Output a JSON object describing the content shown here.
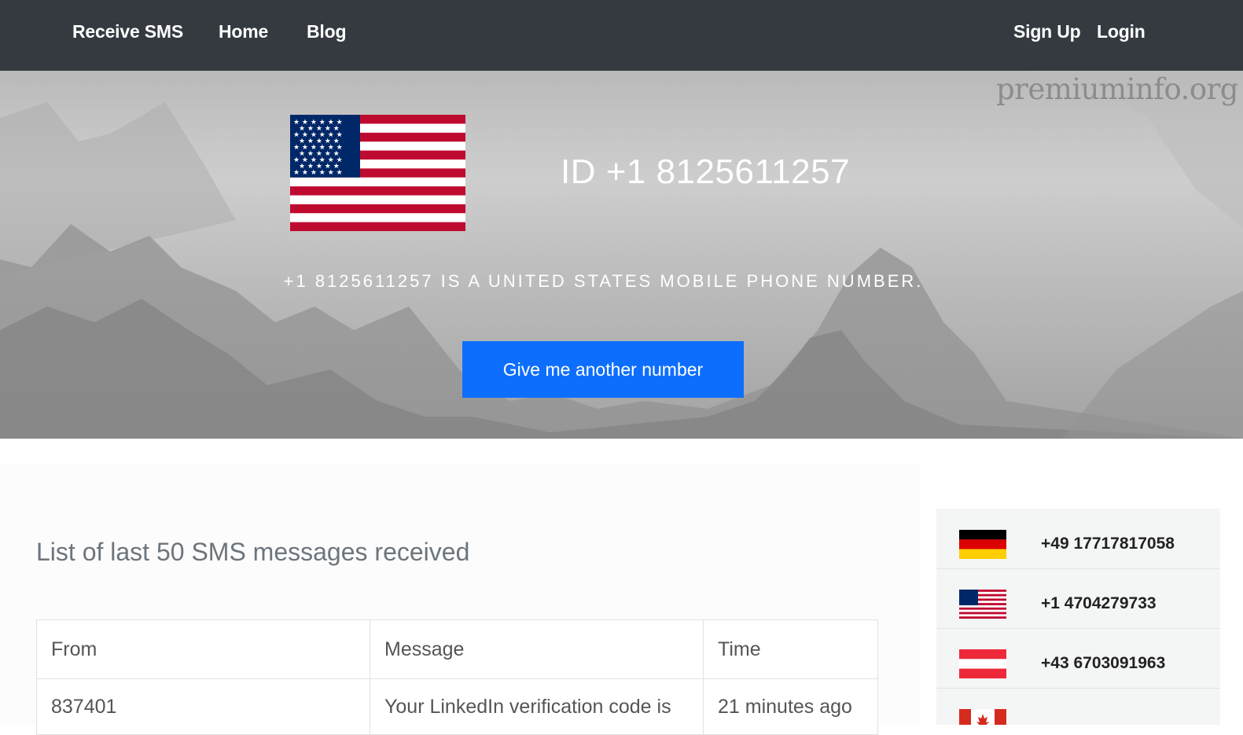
{
  "nav": {
    "brand": "Receive SMS",
    "home": "Home",
    "blog": "Blog",
    "signup": "Sign Up",
    "login": "Login"
  },
  "hero": {
    "watermark": "premiuminfo.org",
    "flag_icon": "us-flag-icon",
    "id_text": "ID +1 8125611257",
    "subtitle": "+1 8125611257 is a United States mobile phone number.",
    "cta_label": "Give me another number"
  },
  "messages": {
    "title": "List of last 50 SMS messages received",
    "columns": [
      "From",
      "Message",
      "Time"
    ],
    "rows": [
      {
        "from": "837401",
        "message": "Your LinkedIn verification code is",
        "time": "21 minutes ago"
      }
    ]
  },
  "sidebar": {
    "numbers": [
      {
        "flag_icon": "germany-flag-icon",
        "number": "+49 17717817058"
      },
      {
        "flag_icon": "us-flag-icon",
        "number": "+1 4704279733"
      },
      {
        "flag_icon": "austria-flag-icon",
        "number": "+43 6703091963"
      },
      {
        "flag_icon": "canada-flag-icon",
        "number": ""
      }
    ]
  },
  "colors": {
    "navbar": "#343a40",
    "cta": "#0d6efd",
    "us_red": "#bf0a30",
    "us_blue": "#002868"
  }
}
